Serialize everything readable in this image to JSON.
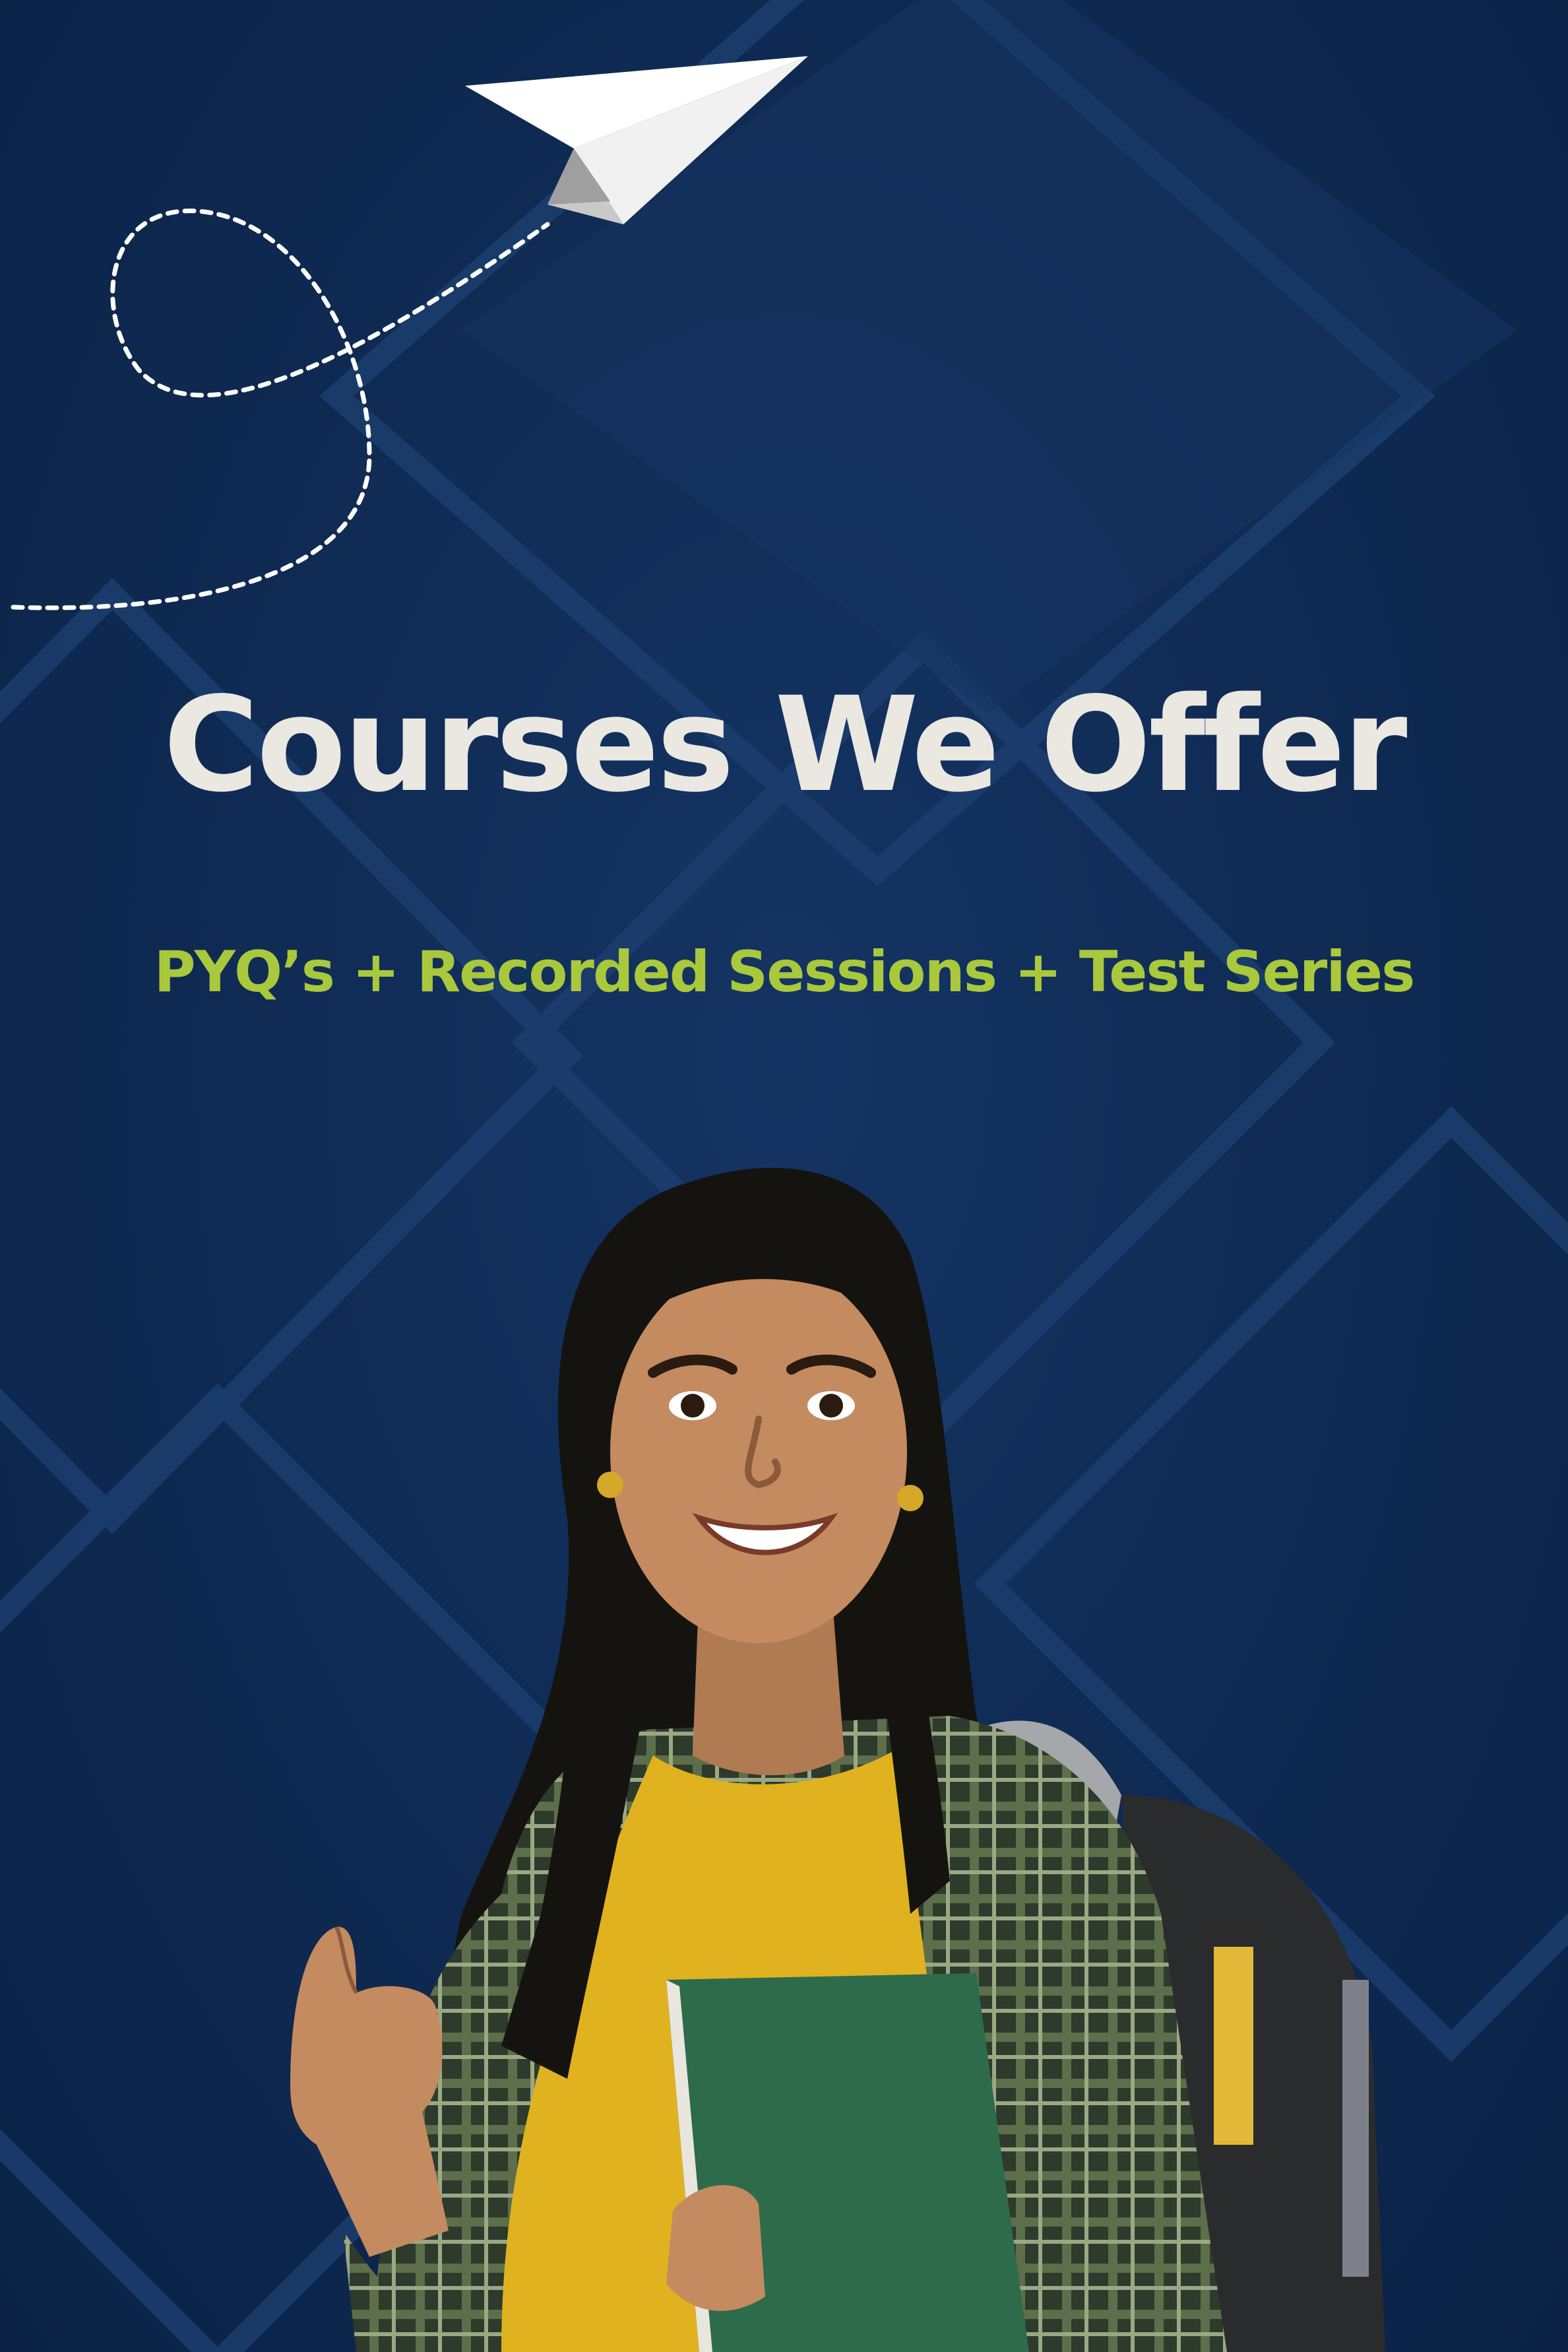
{
  "poster": {
    "title": "Courses We Offer",
    "subtitle": "PYQ’s + Recorded Sessions + Test Series"
  },
  "icons": {
    "paper_plane": "paper-plane-icon",
    "flight_path": "dashed-flight-path",
    "thumbs_up": "thumbs-up-gesture"
  },
  "colors": {
    "background": "#0f2a52",
    "title": "#ebe7e1",
    "subtitle": "#a9c83c"
  }
}
